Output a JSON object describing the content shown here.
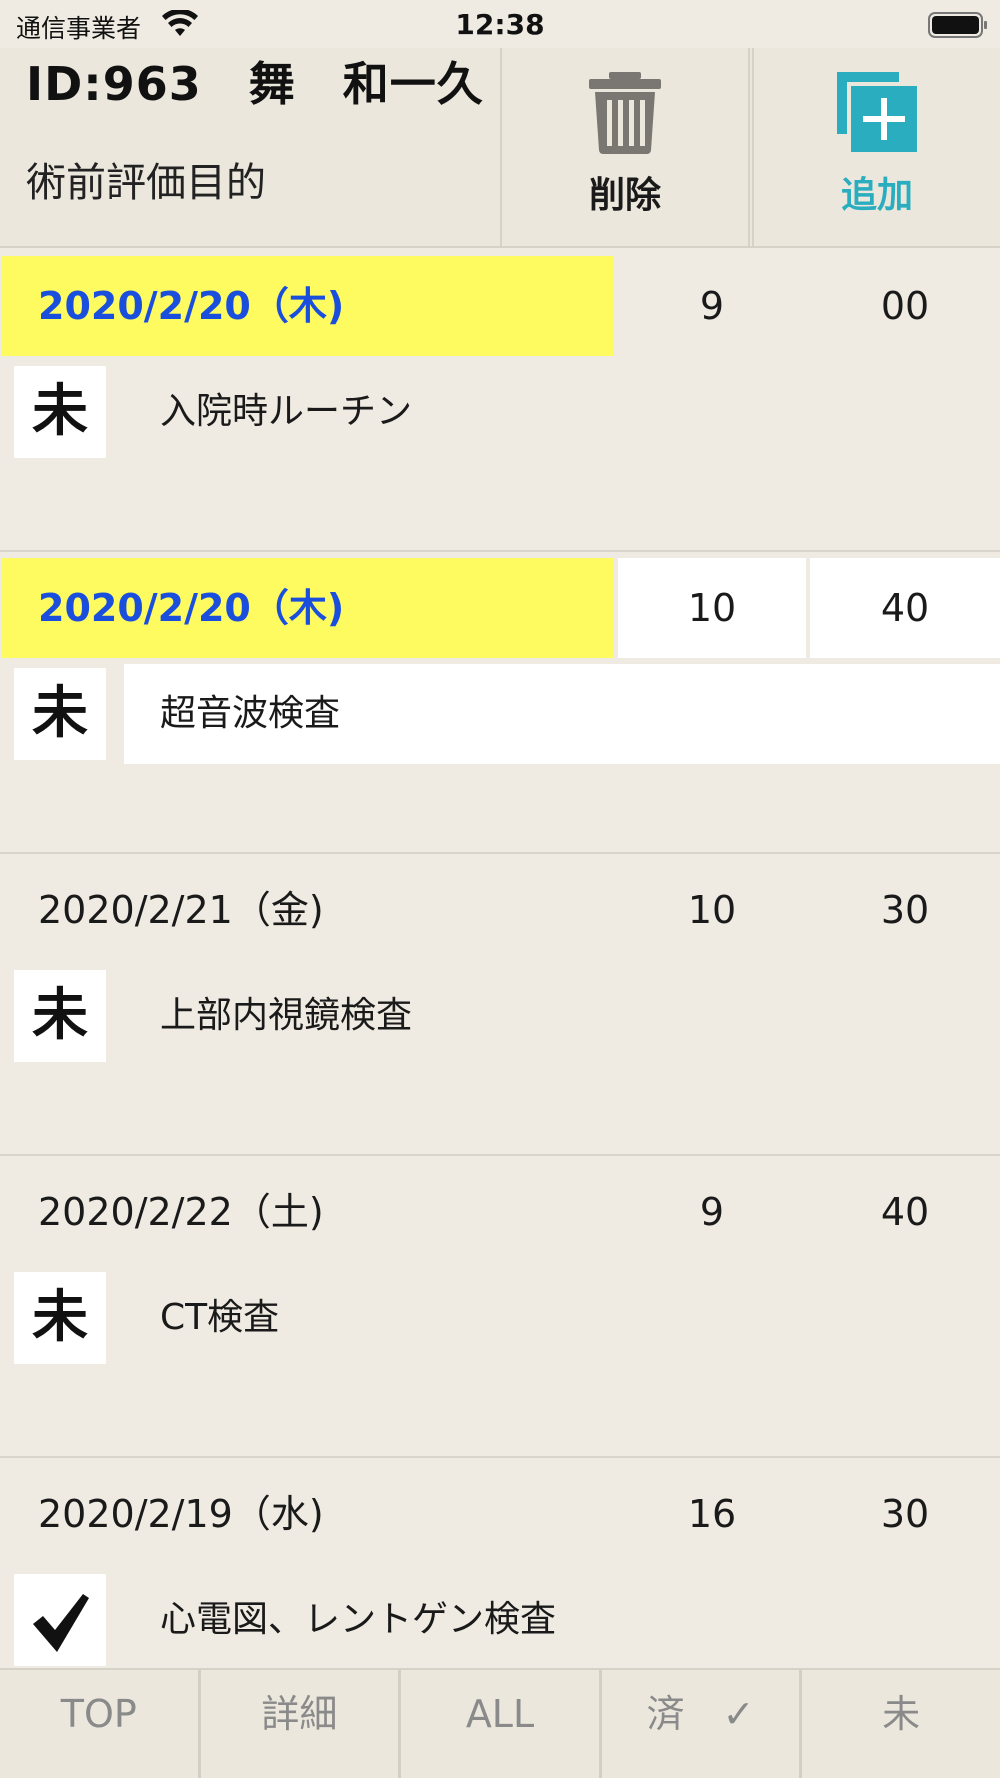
{
  "status_bar": {
    "carrier": "通信事業者",
    "time": "12:38"
  },
  "header": {
    "patient_id": "ID:963　舞　和一久",
    "purpose": "術前評価目的",
    "delete_label": "削除",
    "add_label": "追加",
    "add_icon_color": "#2aaebf",
    "delete_icon_color": "#7a7772"
  },
  "items": [
    {
      "date": "2020/2/20（木)",
      "hour": "9",
      "minute": "00",
      "status": "未",
      "task": "入院時ルーチン",
      "highlight": true
    },
    {
      "date": "2020/2/20（木)",
      "hour": "10",
      "minute": "40",
      "status": "未",
      "task": "超音波検査",
      "highlight": true,
      "selected": true
    },
    {
      "date": "2020/2/21（金)",
      "hour": "10",
      "minute": "30",
      "status": "未",
      "task": "上部内視鏡検査",
      "highlight": false
    },
    {
      "date": "2020/2/22（土)",
      "hour": "9",
      "minute": "40",
      "status": "未",
      "task": "CT検査",
      "highlight": false
    },
    {
      "date": "2020/2/19（水)",
      "hour": "16",
      "minute": "30",
      "status": "check",
      "task": "心電図、レントゲン検査",
      "highlight": false
    }
  ],
  "tabs": [
    {
      "label": "TOP"
    },
    {
      "label": "詳細"
    },
    {
      "label": "ALL"
    },
    {
      "label": "済　✓"
    },
    {
      "label": "未"
    }
  ],
  "colors": {
    "highlight_bg": "#fdfb60",
    "highlight_text": "#1a4fdd",
    "background": "#efebe2"
  }
}
